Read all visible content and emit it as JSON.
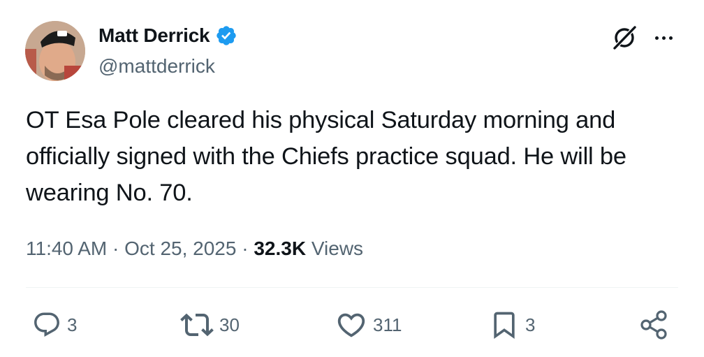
{
  "author": {
    "display_name": "Matt Derrick",
    "handle": "@mattderrick",
    "verified": true
  },
  "tweet": {
    "text": "OT Esa Pole cleared his physical Saturday morning and officially signed with the Chiefs practice squad. He will be wearing No. 70."
  },
  "meta": {
    "time": "11:40 AM",
    "separator": " · ",
    "date": "Oct 25, 2025",
    "views_count": "32.3K",
    "views_label": "Views"
  },
  "actions": {
    "replies": "3",
    "reposts": "30",
    "likes": "311",
    "bookmarks": "3"
  },
  "colors": {
    "text": "#0f1419",
    "secondary": "#536471",
    "verified_badge": "#1d9bf0",
    "divider": "#eff3f4"
  },
  "icons": [
    "verified-badge-icon",
    "grok-icon",
    "more-icon",
    "reply-icon",
    "repost-icon",
    "like-icon",
    "bookmark-icon",
    "share-icon"
  ]
}
